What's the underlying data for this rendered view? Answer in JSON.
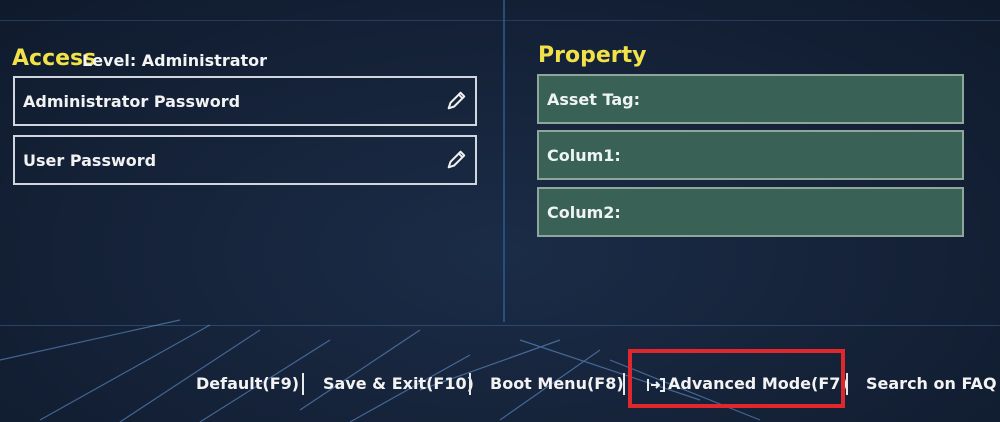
{
  "access": {
    "title": "Access",
    "level_text": "Level: Administrator",
    "fields": [
      {
        "label": "Administrator Password",
        "icon": "pencil-icon"
      },
      {
        "label": "User Password",
        "icon": "pencil-icon"
      }
    ]
  },
  "property": {
    "title": "Property",
    "fields": [
      {
        "label": "Asset Tag:"
      },
      {
        "label": "Colum1:"
      },
      {
        "label": "Colum2:"
      }
    ]
  },
  "bottom_bar": {
    "items": [
      {
        "label": "Default(F9)"
      },
      {
        "label": "Save & Exit(F10)"
      },
      {
        "label": "Boot Menu(F8)"
      },
      {
        "label": "Advanced Mode(F7)",
        "icon": "advanced-mode-icon",
        "highlighted": true
      },
      {
        "label": "Search on FAQ"
      }
    ]
  },
  "colors": {
    "title": "#f2e24a",
    "property_field_bg": "#3a6155",
    "highlight": "#e0272c"
  }
}
